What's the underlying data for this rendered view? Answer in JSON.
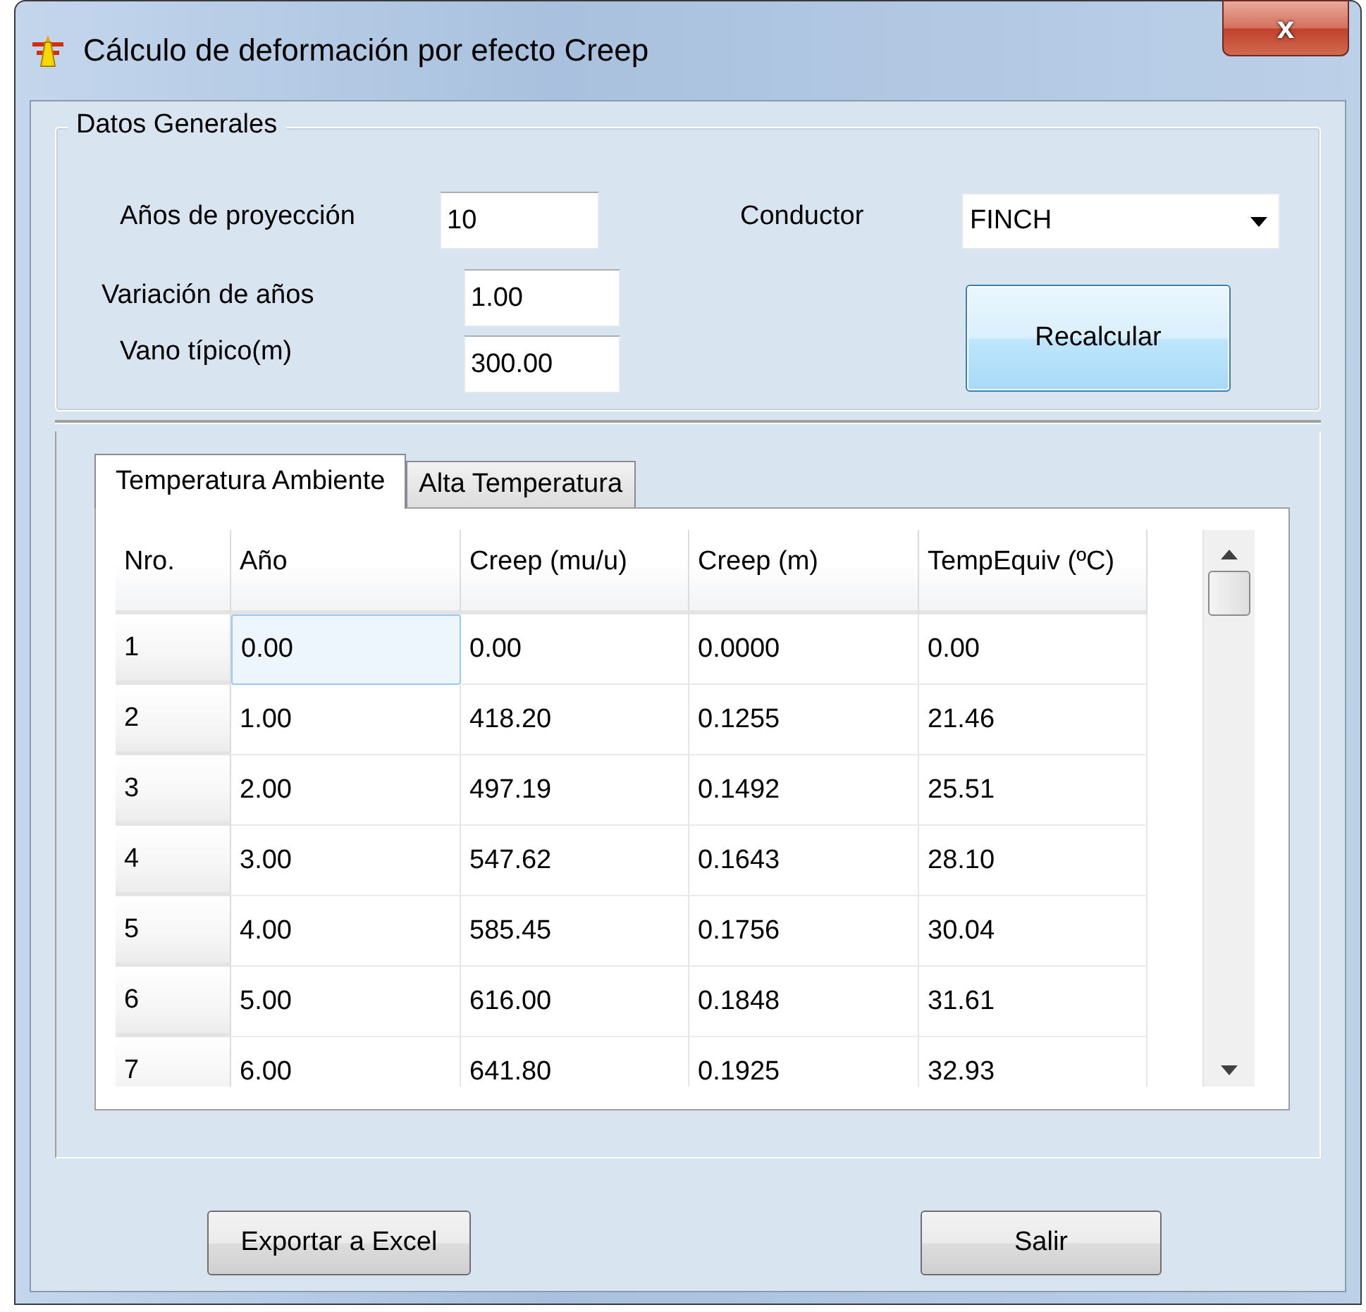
{
  "window": {
    "title": "Cálculo de deformación por efecto Creep",
    "close_label": "x"
  },
  "general": {
    "title": "Datos Generales",
    "fields": [
      {
        "label": "Años de proyección",
        "value": "10"
      },
      {
        "label": "Variación de años",
        "value": "1.00"
      },
      {
        "label": "Vano típico(m)",
        "value": "300.00"
      }
    ],
    "conductor": {
      "label": "Conductor",
      "value": "FINCH"
    },
    "recalc_button": "Recalcular"
  },
  "tabs": [
    {
      "label": "Temperatura Ambiente",
      "selected": true
    },
    {
      "label": "Alta Temperatura",
      "selected": false
    }
  ],
  "table": {
    "columns": [
      "Nro.",
      "Año",
      "Creep (mu/u)",
      "Creep (m)",
      "TempEquiv (ºC)"
    ],
    "rows": [
      {
        "cells": [
          {
            "kind": "header",
            "text": "1",
            "selected": false
          },
          {
            "kind": "data",
            "text": "0.00",
            "selected": true
          },
          {
            "kind": "data",
            "text": "0.00",
            "selected": false
          },
          {
            "kind": "data",
            "text": "0.0000",
            "selected": false
          },
          {
            "kind": "data",
            "text": "0.00",
            "selected": false
          }
        ]
      },
      {
        "cells": [
          {
            "kind": "header",
            "text": "2",
            "selected": false
          },
          {
            "kind": "data",
            "text": "1.00",
            "selected": false
          },
          {
            "kind": "data",
            "text": "418.20",
            "selected": false
          },
          {
            "kind": "data",
            "text": "0.1255",
            "selected": false
          },
          {
            "kind": "data",
            "text": "21.46",
            "selected": false
          }
        ]
      },
      {
        "cells": [
          {
            "kind": "header",
            "text": "3",
            "selected": false
          },
          {
            "kind": "data",
            "text": "2.00",
            "selected": false
          },
          {
            "kind": "data",
            "text": "497.19",
            "selected": false
          },
          {
            "kind": "data",
            "text": "0.1492",
            "selected": false
          },
          {
            "kind": "data",
            "text": "25.51",
            "selected": false
          }
        ]
      },
      {
        "cells": [
          {
            "kind": "header",
            "text": "4",
            "selected": false
          },
          {
            "kind": "data",
            "text": "3.00",
            "selected": false
          },
          {
            "kind": "data",
            "text": "547.62",
            "selected": false
          },
          {
            "kind": "data",
            "text": "0.1643",
            "selected": false
          },
          {
            "kind": "data",
            "text": "28.10",
            "selected": false
          }
        ]
      },
      {
        "cells": [
          {
            "kind": "header",
            "text": "5",
            "selected": false
          },
          {
            "kind": "data",
            "text": "4.00",
            "selected": false
          },
          {
            "kind": "data",
            "text": "585.45",
            "selected": false
          },
          {
            "kind": "data",
            "text": "0.1756",
            "selected": false
          },
          {
            "kind": "data",
            "text": "30.04",
            "selected": false
          }
        ]
      },
      {
        "cells": [
          {
            "kind": "header",
            "text": "6",
            "selected": false
          },
          {
            "kind": "data",
            "text": "5.00",
            "selected": false
          },
          {
            "kind": "data",
            "text": "616.00",
            "selected": false
          },
          {
            "kind": "data",
            "text": "0.1848",
            "selected": false
          },
          {
            "kind": "data",
            "text": "31.61",
            "selected": false
          }
        ]
      },
      {
        "cells": [
          {
            "kind": "header",
            "text": "7",
            "selected": false
          },
          {
            "kind": "data",
            "text": "6.00",
            "selected": false
          },
          {
            "kind": "data",
            "text": "641.80",
            "selected": false
          },
          {
            "kind": "data",
            "text": "0.1925",
            "selected": false
          },
          {
            "kind": "data",
            "text": "32.93",
            "selected": false
          }
        ]
      }
    ]
  },
  "buttons": [
    "Exportar a Excel",
    "Salir"
  ]
}
